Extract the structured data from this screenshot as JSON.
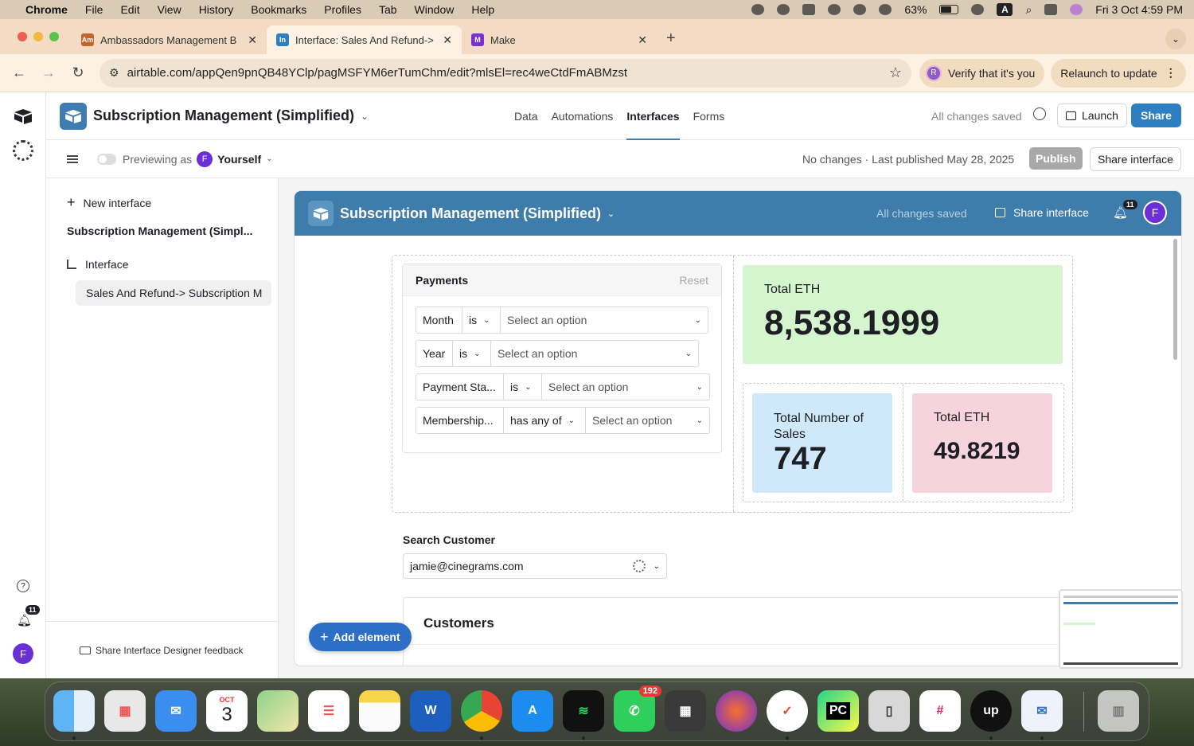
{
  "menubar": {
    "app": "Chrome",
    "items": [
      "File",
      "Edit",
      "View",
      "History",
      "Bookmarks",
      "Profiles",
      "Tab",
      "Window",
      "Help"
    ],
    "battery": "63%",
    "datetime": "Fri 3 Oct  4:59 PM",
    "keyboard": "A"
  },
  "browser": {
    "tabs": [
      {
        "title": "Ambassadors Management B",
        "favicon": "Am",
        "color": "#c0662b"
      },
      {
        "title": "Interface: Sales And Refund->",
        "favicon": "In",
        "color": "#2d7fc1"
      },
      {
        "title": "Make",
        "favicon": "M",
        "color": "#7b2fd6"
      }
    ],
    "url": "airtable.com/appQen9pnQB48YClp/pagMSFYM6erTumChm/edit?mlsEl=rec4weCtdFmABMzst",
    "verify_label": "Verify that it's you",
    "verify_avatar": "R",
    "relaunch_label": "Relaunch to update"
  },
  "rail": {
    "notification_count": "11",
    "avatar": "F"
  },
  "topbar": {
    "base_name": "Subscription Management (Simplified)",
    "nav": [
      "Data",
      "Automations",
      "Interfaces",
      "Forms"
    ],
    "saved_status": "All changes saved",
    "launch_label": "Launch",
    "share_label": "Share"
  },
  "subbar": {
    "previewing_label": "Previewing as",
    "user_avatar": "F",
    "user_name": "Yourself",
    "publish_status": "No changes · Last published May 28, 2025",
    "publish_label": "Publish",
    "share_interface_label": "Share interface"
  },
  "sidebar": {
    "new_interface": "New interface",
    "base_title": "Subscription Management (Simpl...",
    "group": "Interface",
    "page": "Sales And Refund-> Subscription M",
    "feedback": "Share Interface Designer feedback"
  },
  "interface": {
    "title": "Subscription Management (Simplified)",
    "saved": "All changes saved",
    "share": "Share interface",
    "notification_count": "11",
    "avatar": "F",
    "filters": {
      "title": "Payments",
      "reset": "Reset",
      "rows": [
        {
          "field": "Month",
          "op": "is",
          "value": "Select an option"
        },
        {
          "field": "Year",
          "op": "is",
          "value": "Select an option"
        },
        {
          "field": "Payment Sta...",
          "op": "is",
          "value": "Select an option"
        },
        {
          "field": "Membership...",
          "op": "has any of",
          "value": "Select an option"
        }
      ]
    },
    "kpis": {
      "total_eth": {
        "label": "Total ETH",
        "value": "8,538.1999",
        "color": "#d4f5ce"
      },
      "total_sales": {
        "label": "Total Number of Sales",
        "value": "747",
        "color": "#cfe9fb"
      },
      "total_eth_2": {
        "label": "Total ETH",
        "value": "49.8219",
        "color": "#f7d3dd"
      }
    },
    "search": {
      "label": "Search Customer",
      "value": "jamie@cinegrams.com"
    },
    "customers_title": "Customers",
    "add_element": "Add element"
  },
  "dock": {
    "calendar_month": "OCT",
    "calendar_day": "3",
    "whatsapp_badge": "192",
    "apps": [
      "finder",
      "launchpad",
      "mail",
      "calendar",
      "maps",
      "reminders",
      "notes",
      "word",
      "chrome",
      "app-store",
      "spotify",
      "whatsapp",
      "calculator",
      "firefox",
      "ticktick",
      "pycharm",
      "simulator",
      "slack",
      "upwork",
      "mail-app",
      "trash"
    ]
  }
}
